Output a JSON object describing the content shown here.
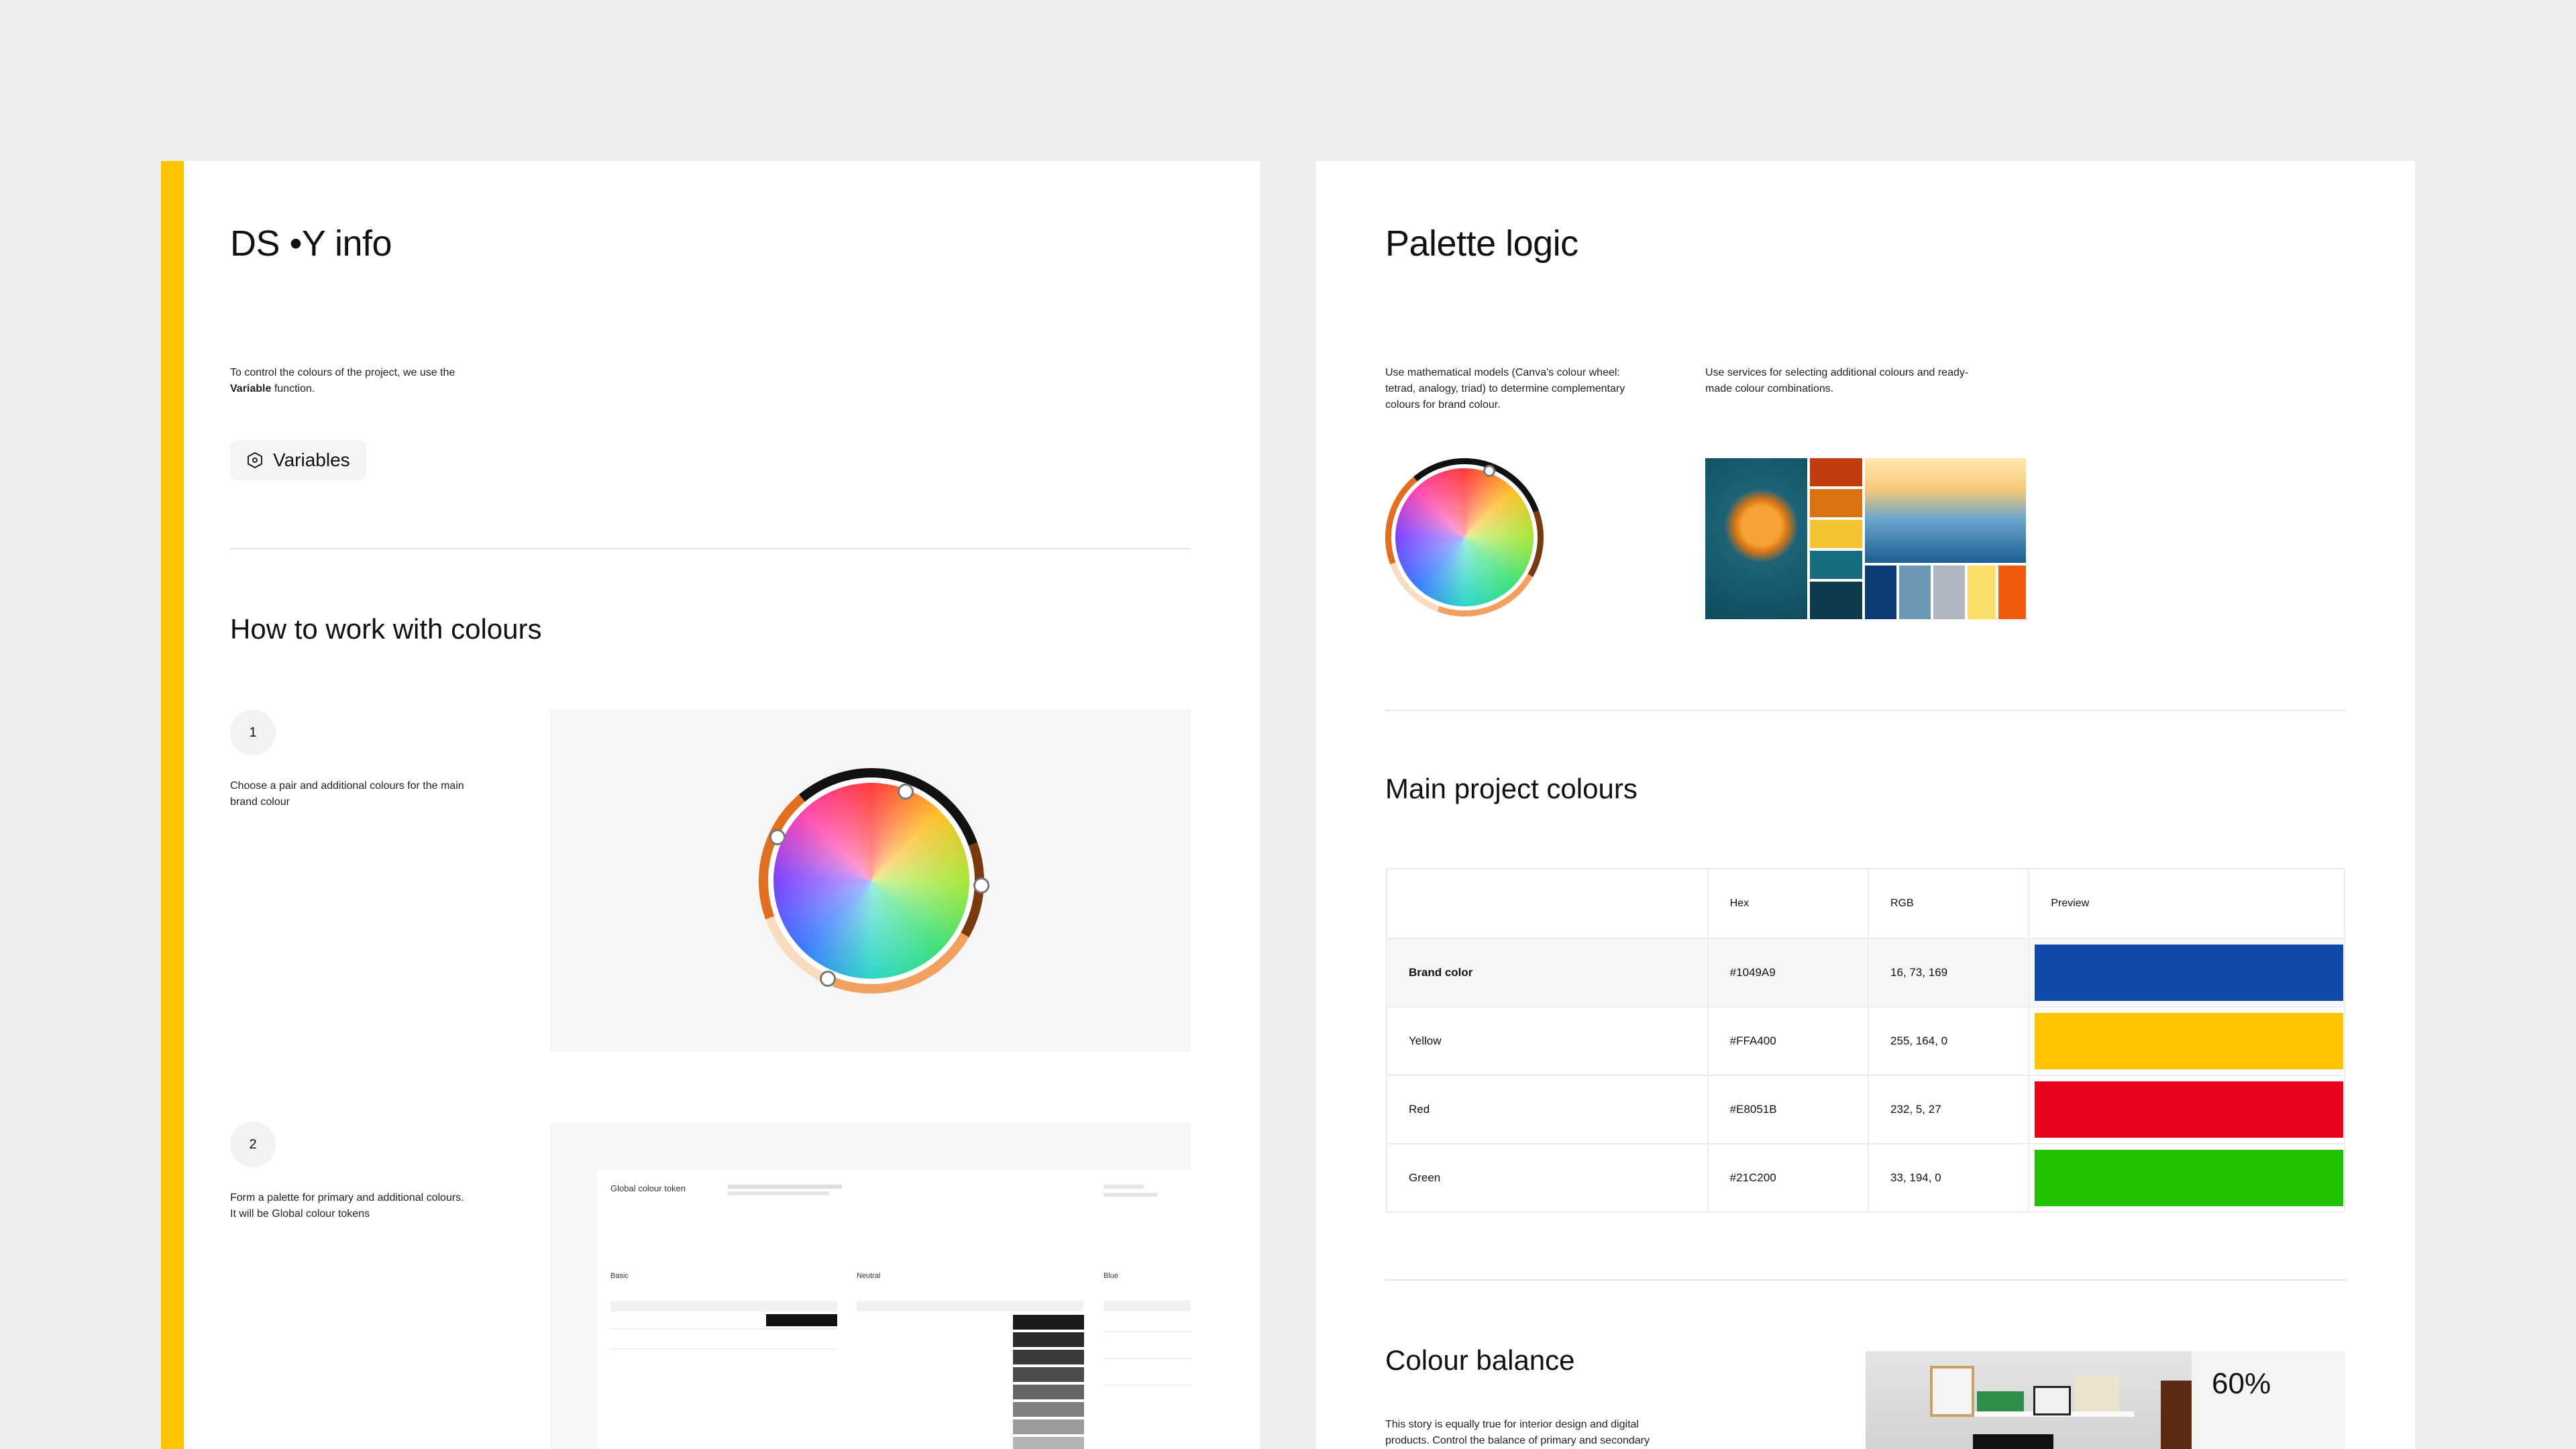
{
  "left": {
    "title": "DS •Y info",
    "intro_line1": "To control the colours of the project, we use the",
    "intro_bold": "Variable",
    "intro_rest": " function.",
    "variables_label": "Variables",
    "section_title": "How to work with colours",
    "step1": {
      "num": "1",
      "text_line1": "Choose a pair and additional colours for the main",
      "text_line2": "brand colour"
    },
    "step2": {
      "num": "2",
      "text_line1": "Form a palette for primary and additional colours.",
      "text_line2": "It will be Global colour tokens"
    },
    "mini": {
      "title": "Global colour token",
      "col_basic": "Basic",
      "col_neutral": "Neutral",
      "col_blue": "Blue"
    }
  },
  "right": {
    "title": "Palette logic",
    "text_a_l1": "Use mathematical models (Canva's colour wheel:",
    "text_a_l2": "tetrad, analogy, triad) to determine complementary",
    "text_a_l3": "colours for brand colour.",
    "text_b_l1": "Use services for selecting additional colours and ready-",
    "text_b_l2": "made colour combinations.",
    "main_title": "Main project colours",
    "table": {
      "headers": [
        "",
        "Hex",
        "RGB",
        "Preview"
      ],
      "rows": [
        {
          "name": "Brand color",
          "hex": "#1049A9",
          "rgb": "16, 73, 169",
          "color": "#1049A9"
        },
        {
          "name": "Yellow",
          "hex": "#FFA400",
          "rgb": "255, 164, 0",
          "color": "#FFC400"
        },
        {
          "name": "Red",
          "hex": "#E8051B",
          "rgb": "232, 5, 27",
          "color": "#E8051B"
        },
        {
          "name": "Green",
          "hex": "#21C200",
          "rgb": "33, 194, 0",
          "color": "#21C200"
        }
      ]
    },
    "balance_title": "Colour balance",
    "balance_l1": "This story is equally true for interior design and digital",
    "balance_l2": "products. Control the balance of primary and secondary",
    "balance_pct": "60%"
  },
  "colors": {
    "accent": "#FFC400",
    "bg": "#EEEEEE"
  }
}
